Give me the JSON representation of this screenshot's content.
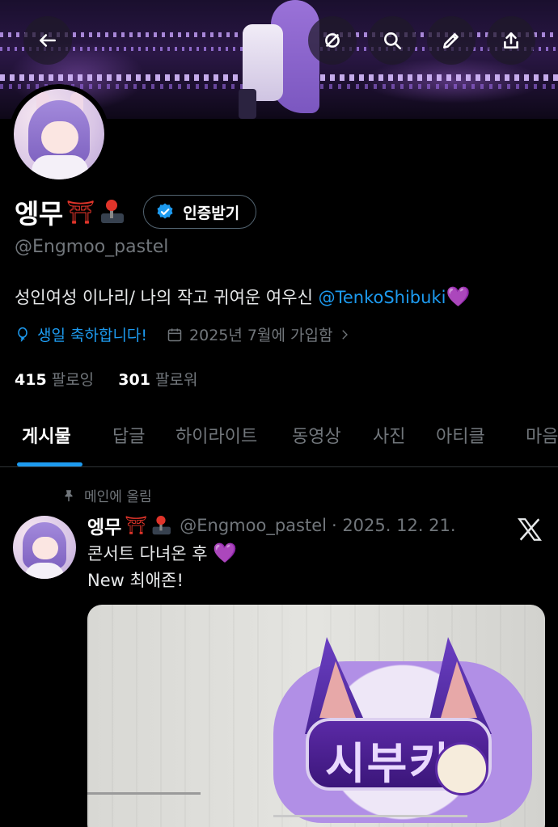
{
  "header": {
    "back_icon": "arrow-left-icon",
    "actions": [
      {
        "name": "unfollow-circle-icon"
      },
      {
        "name": "search-icon"
      },
      {
        "name": "edit-pencil-icon"
      },
      {
        "name": "share-upload-icon"
      }
    ]
  },
  "profile": {
    "display_name": "엥무",
    "name_emojis": [
      "⛩",
      "🕹"
    ],
    "verify_button_label": "인증받기",
    "handle": "@Engmoo_pastel",
    "bio_text": "성인여성 이나리/ 나의 작고 귀여운 여우신 ",
    "bio_mention": "@TenkoShibuki",
    "bio_heart": "💜",
    "birthday_text": "생일 축하합니다!",
    "joined_text": "2025년 7월에 가입함",
    "following_count": "415",
    "following_label": "팔로잉",
    "followers_count": "301",
    "followers_label": "팔로워"
  },
  "tabs": [
    {
      "label": "게시물",
      "active": true
    },
    {
      "label": "답글"
    },
    {
      "label": "하이라이트"
    },
    {
      "label": "동영상"
    },
    {
      "label": "사진"
    },
    {
      "label": "아티클"
    },
    {
      "label": "마음"
    }
  ],
  "pinned_post": {
    "pinned_label": "메인에 올림",
    "author_name": "엥무",
    "author_handle": "@Engmoo_pastel",
    "date": "· 2025. 12. 21.",
    "line1": "콘서트 다녀온 후 ",
    "line1_emoji": "💜",
    "line2": "New 최애존!",
    "image_text": "시부키"
  },
  "colors": {
    "accent": "#1d9bf0",
    "muted": "#71767b",
    "heart": "#a64df0"
  }
}
